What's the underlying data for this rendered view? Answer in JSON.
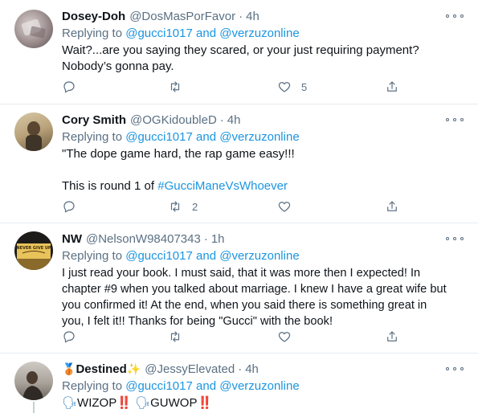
{
  "tweets": [
    {
      "name": "Dosey-Doh",
      "handle": "@DosMasPorFavor",
      "time": "4h",
      "replying_prefix": "Replying to",
      "replying_users": [
        "@gucci1017",
        "and",
        "@verzuzonline"
      ],
      "lines": [
        "Wait?...are you saying they scared, or your just requiring payment?",
        "Nobody’s gonna pay."
      ],
      "counts": {
        "reply": "",
        "retweet": "",
        "like": "5"
      }
    },
    {
      "name": "Cory Smith",
      "handle": "@OGKidoubleD",
      "time": "4h",
      "replying_prefix": "Replying to",
      "replying_users": [
        "@gucci1017",
        "and",
        "@verzuzonline"
      ],
      "lines": [
        "\"The dope game hard, the rap game easy!!!"
      ],
      "line3_prefix": "This is round 1 of ",
      "line3_tag": "#GucciManeVsWhoever",
      "counts": {
        "reply": "",
        "retweet": "2",
        "like": ""
      }
    },
    {
      "name": "NW",
      "handle": "@NelsonW98407343",
      "time": "1h",
      "replying_prefix": "Replying to",
      "replying_users": [
        "@gucci1017",
        "and",
        "@verzuzonline"
      ],
      "lines": [
        "I just read your book. I must said, that it was more then I expected! In",
        "chapter #9 when you talked about marriage. I knew I have a great wife but",
        "you confirmed it! At the end, when you said there is something great in",
        "you, I felt it!! Thanks for being \"Gucci\" with the book!"
      ],
      "avatar_text": "NEVER GIVE UP",
      "counts": {
        "reply": "",
        "retweet": "",
        "like": ""
      }
    },
    {
      "name_emoji_pre": "🥉",
      "name": "Destined",
      "name_emoji_post": "✨",
      "handle": "@JessyElevated",
      "time": "4h",
      "replying_prefix": "Replying to",
      "replying_users": [
        "@gucci1017",
        "and",
        "@verzuzonline"
      ],
      "line_parts": [
        "🗣",
        "WIZOP",
        "‼️",
        " ",
        "🗣",
        "GUWOP",
        "‼️"
      ]
    }
  ],
  "colors": {
    "link": "#1b95e0",
    "secondary": "#5b7083",
    "divider": "#e6ecf0",
    "text": "#0f1419"
  },
  "icons": [
    "reply-icon",
    "retweet-icon",
    "like-icon",
    "share-icon",
    "more-icon"
  ]
}
